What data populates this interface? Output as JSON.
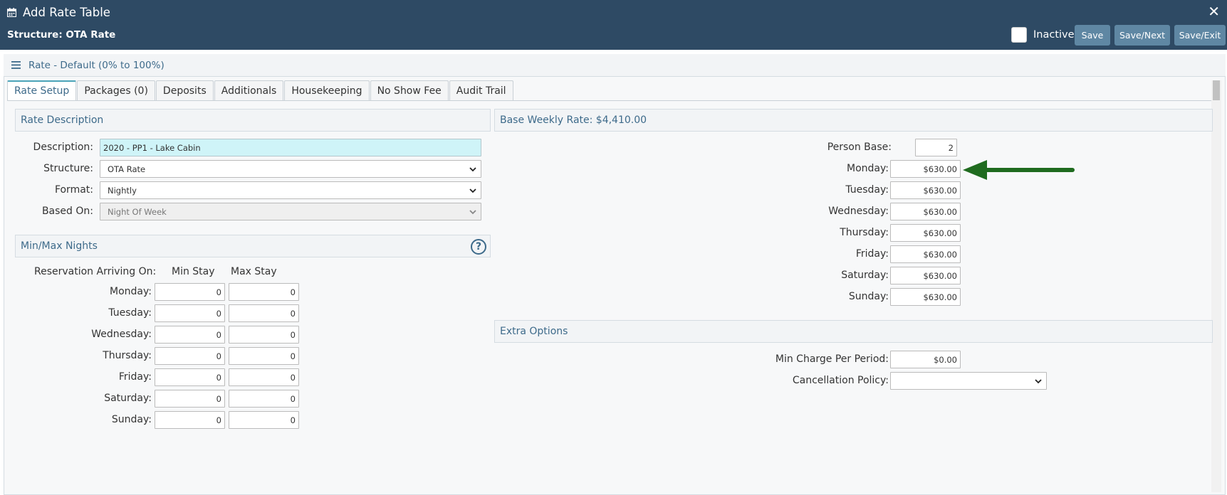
{
  "window": {
    "title": "Add Rate Table",
    "structure_line": "Structure: OTA Rate",
    "close_glyph": "✕",
    "inactive_label": "Inactive",
    "inactive_checked": false,
    "buttons": {
      "save": "Save",
      "save_next": "Save/Next",
      "save_exit": "Save/Exit"
    }
  },
  "panel": {
    "title": "Rate - Default (0% to 100%)"
  },
  "tabs": [
    {
      "label": "Rate Setup",
      "active": true
    },
    {
      "label": "Packages (0)"
    },
    {
      "label": "Deposits"
    },
    {
      "label": "Additionals"
    },
    {
      "label": "Housekeeping"
    },
    {
      "label": "No Show Fee"
    },
    {
      "label": "Audit Trail"
    }
  ],
  "rate_description": {
    "section_title": "Rate Description",
    "description_label": "Description:",
    "description_value": "2020 - PP1 - Lake Cabin",
    "structure_label": "Structure:",
    "structure_value": "OTA Rate",
    "format_label": "Format:",
    "format_value": "Nightly",
    "based_on_label": "Based On:",
    "based_on_value": "Night Of Week"
  },
  "min_max": {
    "section_title": "Min/Max Nights",
    "help_glyph": "?",
    "arriving_label": "Reservation Arriving On:",
    "min_header": "Min Stay",
    "max_header": "Max Stay",
    "rows": [
      {
        "day": "Monday:",
        "min": "0",
        "max": "0"
      },
      {
        "day": "Tuesday:",
        "min": "0",
        "max": "0"
      },
      {
        "day": "Wednesday:",
        "min": "0",
        "max": "0"
      },
      {
        "day": "Thursday:",
        "min": "0",
        "max": "0"
      },
      {
        "day": "Friday:",
        "min": "0",
        "max": "0"
      },
      {
        "day": "Saturday:",
        "min": "0",
        "max": "0"
      },
      {
        "day": "Sunday:",
        "min": "0",
        "max": "0"
      }
    ]
  },
  "base_rate": {
    "section_title": "Base Weekly Rate: $4,410.00",
    "person_base_label": "Person Base:",
    "person_base_value": "2",
    "days": [
      {
        "day": "Monday:",
        "value": "$630.00"
      },
      {
        "day": "Tuesday:",
        "value": "$630.00"
      },
      {
        "day": "Wednesday:",
        "value": "$630.00"
      },
      {
        "day": "Thursday:",
        "value": "$630.00"
      },
      {
        "day": "Friday:",
        "value": "$630.00"
      },
      {
        "day": "Saturday:",
        "value": "$630.00"
      },
      {
        "day": "Sunday:",
        "value": "$630.00"
      }
    ]
  },
  "extra_options": {
    "section_title": "Extra Options",
    "min_charge_label": "Min Charge Per Period:",
    "min_charge_value": "$0.00",
    "cancellation_label": "Cancellation Policy:",
    "cancellation_value": ""
  },
  "icons": {
    "title_icon": "calendar-icon",
    "menu_icon": "hamburger-icon",
    "help_icon": "question-circle-icon",
    "annotation": "green-arrow-icon"
  },
  "colors": {
    "header_bg": "#2e4a64",
    "button_bg": "#5f87a3",
    "accent_text": "#3d6a8a",
    "description_bg": "#cff4f8",
    "arrow": "#1f6b1f"
  }
}
